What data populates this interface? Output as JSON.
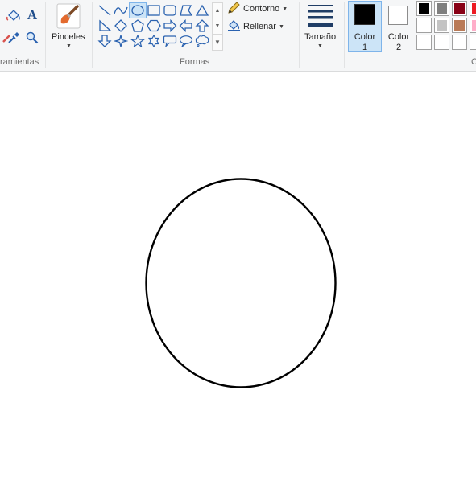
{
  "ribbon": {
    "tools_group": {
      "label": "ramientas",
      "icons": [
        "paint-bucket-icon",
        "text-icon",
        "pencil-icon",
        "color-picker-icon",
        "magnifier-icon"
      ],
      "text_icon_glyph": "A"
    },
    "brushes": {
      "label": "Pinceles",
      "icon": "brush-icon"
    },
    "shapes": {
      "label": "Formas",
      "selected": "oval",
      "items": [
        "line",
        "curve",
        "oval",
        "rectangle",
        "rounded-rectangle",
        "polygon",
        "triangle",
        "right-triangle",
        "diamond",
        "pentagon",
        "hexagon",
        "right-arrow",
        "left-arrow",
        "up-arrow",
        "down-arrow",
        "four-point-star",
        "five-point-star",
        "six-point-star",
        "rounded-callout",
        "oval-callout",
        "cloud-callout"
      ],
      "outline_label": "Contorno",
      "fill_label": "Rellenar"
    },
    "size": {
      "label": "Tamaño"
    },
    "color1": {
      "label_line1": "Color",
      "label_line2": "1",
      "value": "#000000"
    },
    "color2": {
      "label_line1": "Color",
      "label_line2": "2",
      "value": "#ffffff"
    },
    "colors_group_label_partial": "C",
    "palette": [
      [
        "#000000",
        "#7f7f7f",
        "#880015",
        "#ed1c24"
      ],
      [
        "#ffffff",
        "#c3c3c3",
        "#b97a57",
        "#ffaec9"
      ],
      [
        "",
        "",
        "",
        ""
      ]
    ]
  },
  "canvas": {
    "shape": "oval",
    "stroke_color": "#000000",
    "fill": "none"
  }
}
